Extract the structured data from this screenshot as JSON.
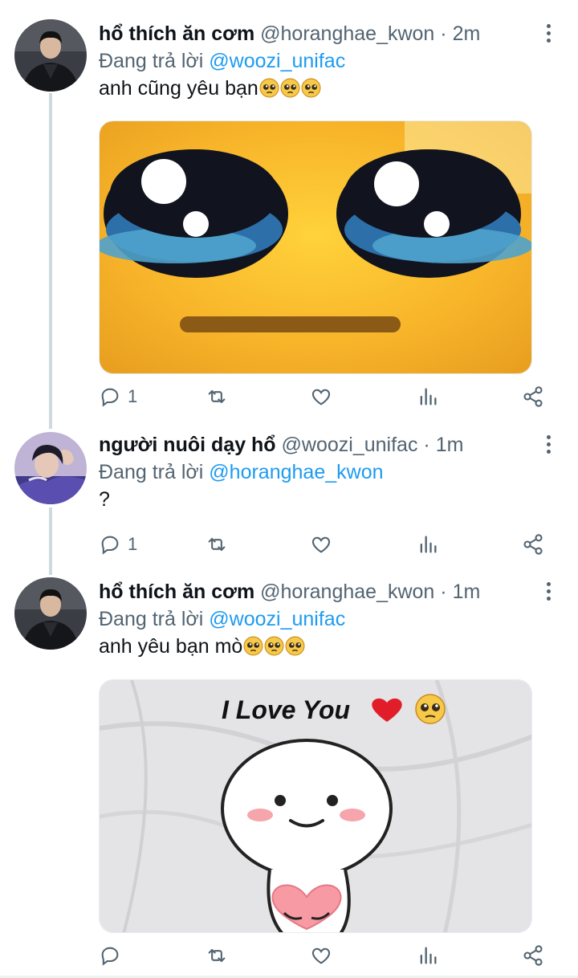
{
  "colors": {
    "link": "#1d9bf0",
    "secondary_text": "#536471",
    "thread_line": "#cfd9de"
  },
  "tweets": [
    {
      "display_name": "hổ thích ăn cơm",
      "handle": "@horanghae_kwon",
      "separator": "·",
      "time": "2m",
      "reply_prefix": "Đang trả lời",
      "reply_to": "@woozi_unifac",
      "text": "anh cũng yêu bạn",
      "emojis": [
        "pleading-face",
        "pleading-face",
        "pleading-face"
      ],
      "media": "crying-yellow-face-closeup",
      "reply_count": "1",
      "retweet_count": "",
      "like_count": ""
    },
    {
      "display_name": "người nuôi dạy hổ",
      "handle": "@woozi_unifac",
      "separator": "·",
      "time": "1m",
      "reply_prefix": "Đang trả lời",
      "reply_to": "@horanghae_kwon",
      "text": "?",
      "emojis": [],
      "media": "",
      "reply_count": "1",
      "retweet_count": "",
      "like_count": ""
    },
    {
      "display_name": "hổ thích ăn cơm",
      "handle": "@horanghae_kwon",
      "separator": "·",
      "time": "1m",
      "reply_prefix": "Đang trả lời",
      "reply_to": "@woozi_unifac",
      "text": "anh yêu bạn mò",
      "emojis": [
        "pleading-face",
        "pleading-face",
        "pleading-face"
      ],
      "media": "cartoon-holding-heart",
      "media_caption": "I Love You",
      "reply_count": "",
      "retweet_count": "",
      "like_count": ""
    }
  ],
  "icons": {
    "reply": "reply-icon",
    "retweet": "retweet-icon",
    "like": "heart-icon",
    "analytics": "analytics-icon",
    "share": "share-icon",
    "more": "more-options-icon"
  }
}
